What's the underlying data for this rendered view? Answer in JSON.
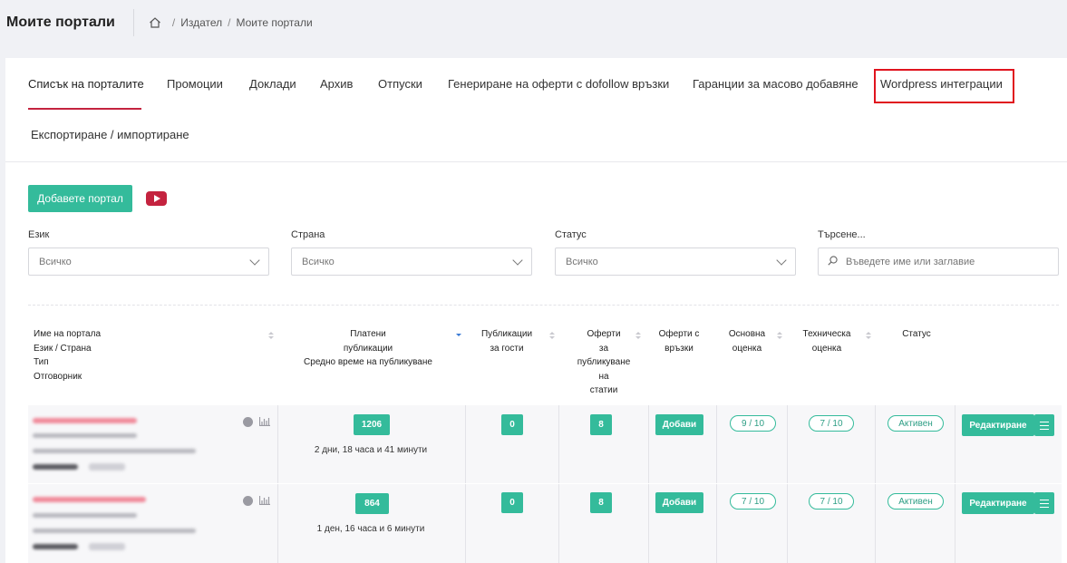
{
  "header": {
    "title": "Моите портали",
    "breadcrumb": [
      "Издател",
      "Моите портали"
    ]
  },
  "tabs": [
    "Списък на порталите",
    "Промоции",
    "Доклади",
    "Архив",
    "Отпуски",
    "Генериране на оферти с dofollow връзки",
    "Гаранции за масово добавяне",
    "Wordpress интеграции",
    "Експортиране / импортиране"
  ],
  "add_button": "Добавете портал",
  "filters": {
    "language": {
      "label": "Език",
      "value": "Всичко"
    },
    "country": {
      "label": "Страна",
      "value": "Всичко"
    },
    "status": {
      "label": "Статус",
      "value": "Всичко"
    },
    "search": {
      "label": "Търсене...",
      "placeholder": "Въведете име или заглавие"
    }
  },
  "columns": {
    "name": [
      "Име на портала",
      "Език / Страна",
      "Тип",
      "Отговорник"
    ],
    "paid": [
      "Платени",
      "публикации",
      "Средно време на публикуване"
    ],
    "guest": [
      "Публикации",
      "за гости"
    ],
    "offers": [
      "Оферти",
      "за",
      "публикуване",
      "на",
      "статии"
    ],
    "offers_links": [
      "Оферти с",
      "връзки"
    ],
    "base_score": [
      "Основна",
      "оценка"
    ],
    "tech_score": [
      "Техническа",
      "оценка"
    ],
    "status": "Статус"
  },
  "rows": [
    {
      "paid": "1206",
      "avg_time": "2 дни, 18 часа и 41 минути",
      "guest": "0",
      "offers": "8",
      "add_label": "Добави",
      "base_score": "9 / 10",
      "tech_score": "7 / 10",
      "status": "Активен",
      "edit": "Редактиране"
    },
    {
      "paid": "864",
      "avg_time": "1 ден, 16 часа и 6 минути",
      "guest": "0",
      "offers": "8",
      "add_label": "Добави",
      "base_score": "7 / 10",
      "tech_score": "7 / 10",
      "status": "Активен",
      "edit": "Редактиране"
    }
  ],
  "colors": {
    "accent": "#34bb9b",
    "brand_red": "#c4233f",
    "highlight": "#e0141e"
  }
}
